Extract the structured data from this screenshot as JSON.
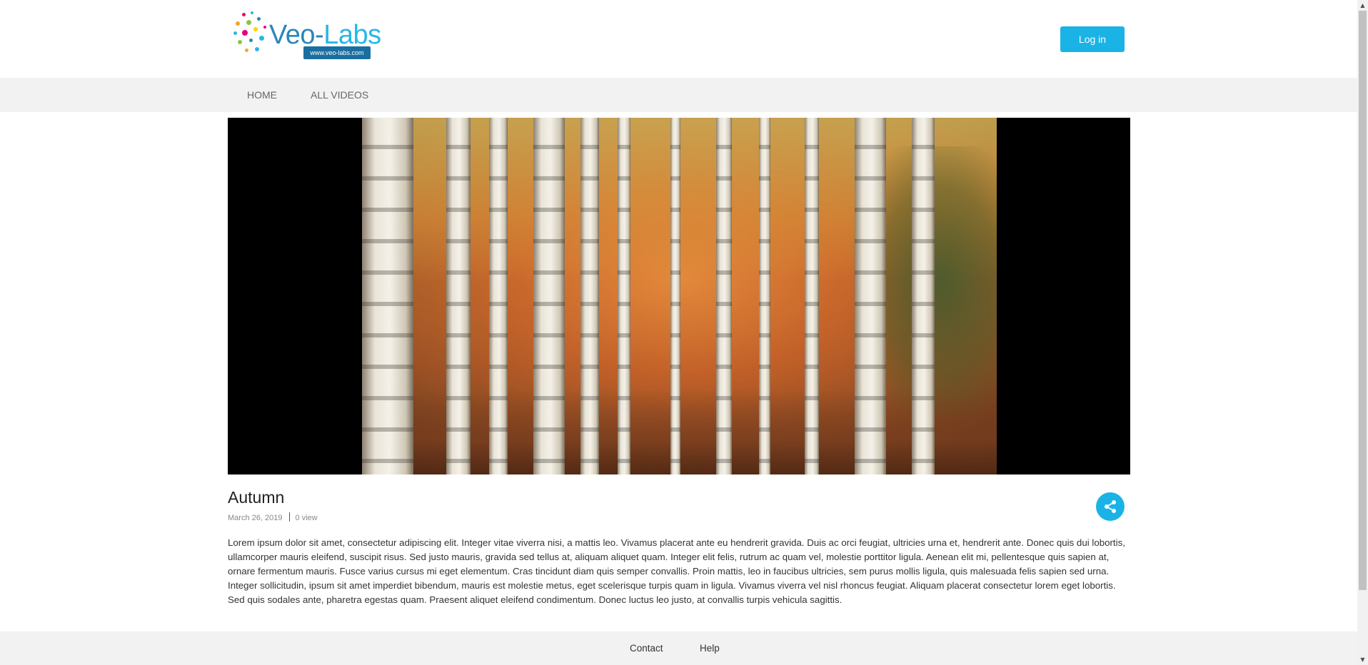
{
  "header": {
    "logo": {
      "name": "Veo",
      "dash": "-",
      "accent": "Labs",
      "url_badge": "www.veo-labs.com"
    },
    "login_label": "Log in"
  },
  "nav": {
    "items": [
      {
        "label": "HOME"
      },
      {
        "label": "ALL VIDEOS"
      }
    ]
  },
  "video": {
    "title": "Autumn",
    "date": "March 26, 2019",
    "views": "0 view",
    "description": "Lorem ipsum dolor sit amet, consectetur adipiscing elit. Integer vitae viverra nisi, a mattis leo. Vivamus placerat ante eu hendrerit gravida. Duis ac orci feugiat, ultricies urna et, hendrerit ante. Donec quis dui lobortis, ullamcorper mauris eleifend, suscipit risus. Sed justo mauris, gravida sed tellus at, aliquam aliquet quam. Integer elit felis, rutrum ac quam vel, molestie porttitor ligula. Aenean elit mi, pellentesque quis sapien at, ornare fermentum mauris. Fusce varius cursus mi eget elementum. Cras tincidunt diam quis semper convallis. Proin mattis, leo in faucibus ultricies, sem purus mollis ligula, quis malesuada felis sapien sed urna. Integer sollicitudin, ipsum sit amet imperdiet bibendum, mauris est molestie metus, eget scelerisque turpis quam in ligula. Vivamus viverra vel nisl rhoncus feugiat. Aliquam placerat consectetur lorem eget lobortis. Sed quis sodales ante, pharetra egestas quam. Praesent aliquet eleifend condimentum. Donec luctus leo justo, at convallis turpis vehicula sagittis.",
    "share_icon": "share-icon"
  },
  "footer": {
    "links": [
      {
        "label": "Contact"
      },
      {
        "label": "Help"
      }
    ]
  },
  "colors": {
    "accent": "#1ab3e6",
    "nav_background": "#f2f2f2",
    "logo_blue": "#2a86b8"
  }
}
